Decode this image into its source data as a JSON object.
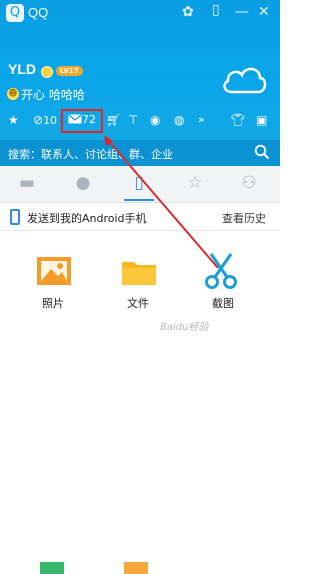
{
  "header": {
    "app_title": "QQ",
    "nickname": "YLD",
    "level_badge": "LV17",
    "signature": "开心 哈哈哈",
    "colors": {
      "header_bg": "#0aa6e9",
      "search_bg": "#0a92d2",
      "accent": "#2f8fdd",
      "highlight": "#e2252a"
    }
  },
  "toolbar": {
    "items": [
      {
        "icon": "star-icon",
        "label": ""
      },
      {
        "icon": "qzone-icon",
        "label": "10"
      },
      {
        "icon": "mail-icon",
        "label": "72"
      },
      {
        "icon": "shopping-cart-icon",
        "label": ""
      },
      {
        "icon": "app-icon",
        "label": ""
      },
      {
        "icon": "app-icon",
        "label": ""
      },
      {
        "icon": "app-icon",
        "label": ""
      },
      {
        "icon": "more-icon",
        "label": "»"
      },
      {
        "icon": "shirt-icon",
        "label": ""
      },
      {
        "icon": "message-box-icon",
        "label": ""
      }
    ]
  },
  "search": {
    "text": "搜索：联系人、讨论组、群、企业"
  },
  "tabs": [
    {
      "icon": "chat-icon"
    },
    {
      "icon": "contact-icon"
    },
    {
      "icon": "phone-icon",
      "active": true
    },
    {
      "icon": "star-icon"
    },
    {
      "icon": "group-icon"
    }
  ],
  "device_row": {
    "text": "发送到我的Android手机",
    "history": "查看历史"
  },
  "tiles": [
    {
      "label": "照片",
      "icon": "photo-icon"
    },
    {
      "label": "文件",
      "icon": "folder-icon"
    },
    {
      "label": "截图",
      "icon": "scissors-icon"
    }
  ],
  "watermark": "Baidu经验"
}
